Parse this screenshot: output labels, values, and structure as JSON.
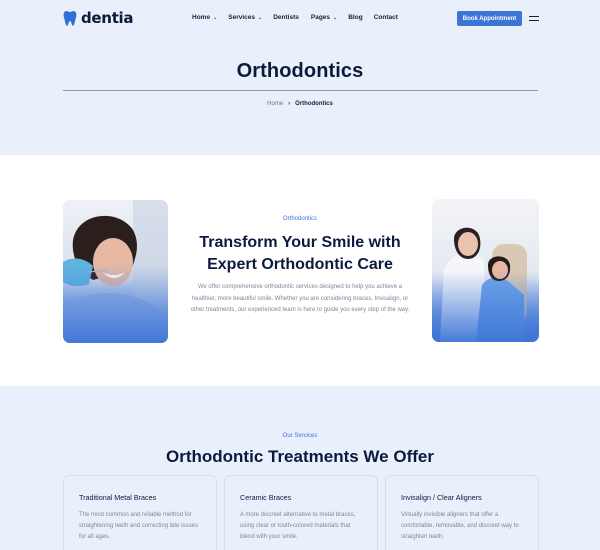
{
  "brand": {
    "name": "dentia",
    "accent": "#3d75d6"
  },
  "nav": {
    "items": [
      {
        "label": "Home",
        "caret": "⌄"
      },
      {
        "label": "Services",
        "caret": "⌄"
      },
      {
        "label": "Dentists"
      },
      {
        "label": "Pages",
        "caret": "⌄"
      },
      {
        "label": "Blog"
      },
      {
        "label": "Contact"
      }
    ],
    "cta": "Book Appointment",
    "menu_icon": "hamburger-icon"
  },
  "page_header": {
    "title": "Orthodontics",
    "breadcrumb": {
      "home": "Home",
      "separator": "›",
      "current": "Orthodontics"
    }
  },
  "intro": {
    "eyebrow": "Orthodontics",
    "heading_line1": "Transform Your Smile with",
    "heading_line2": "Expert Orthodontic Care",
    "paragraph": "We offer comprehensive orthodontic services designed to help you achieve a healthier, more beautiful smile. Whether you are considering braces, Invisalign, or other treatments, our experienced team is here to guide you every step of the way."
  },
  "services": {
    "eyebrow": "Our Services",
    "heading": "Orthodontic Treatments We Offer",
    "cards": [
      {
        "title": "Traditional Metal Braces",
        "text": "The most common and reliable method for straightening teeth and correcting bite issues for all ages."
      },
      {
        "title": "Ceramic Braces",
        "text": "A more discreet alternative to metal braces, using clear or tooth-colored materials that blend with your smile."
      },
      {
        "title": "Invisalign / Clear Aligners",
        "text": "Virtually invisible aligners that offer a comfortable, removable, and discreet way to straighten teeth."
      }
    ]
  }
}
